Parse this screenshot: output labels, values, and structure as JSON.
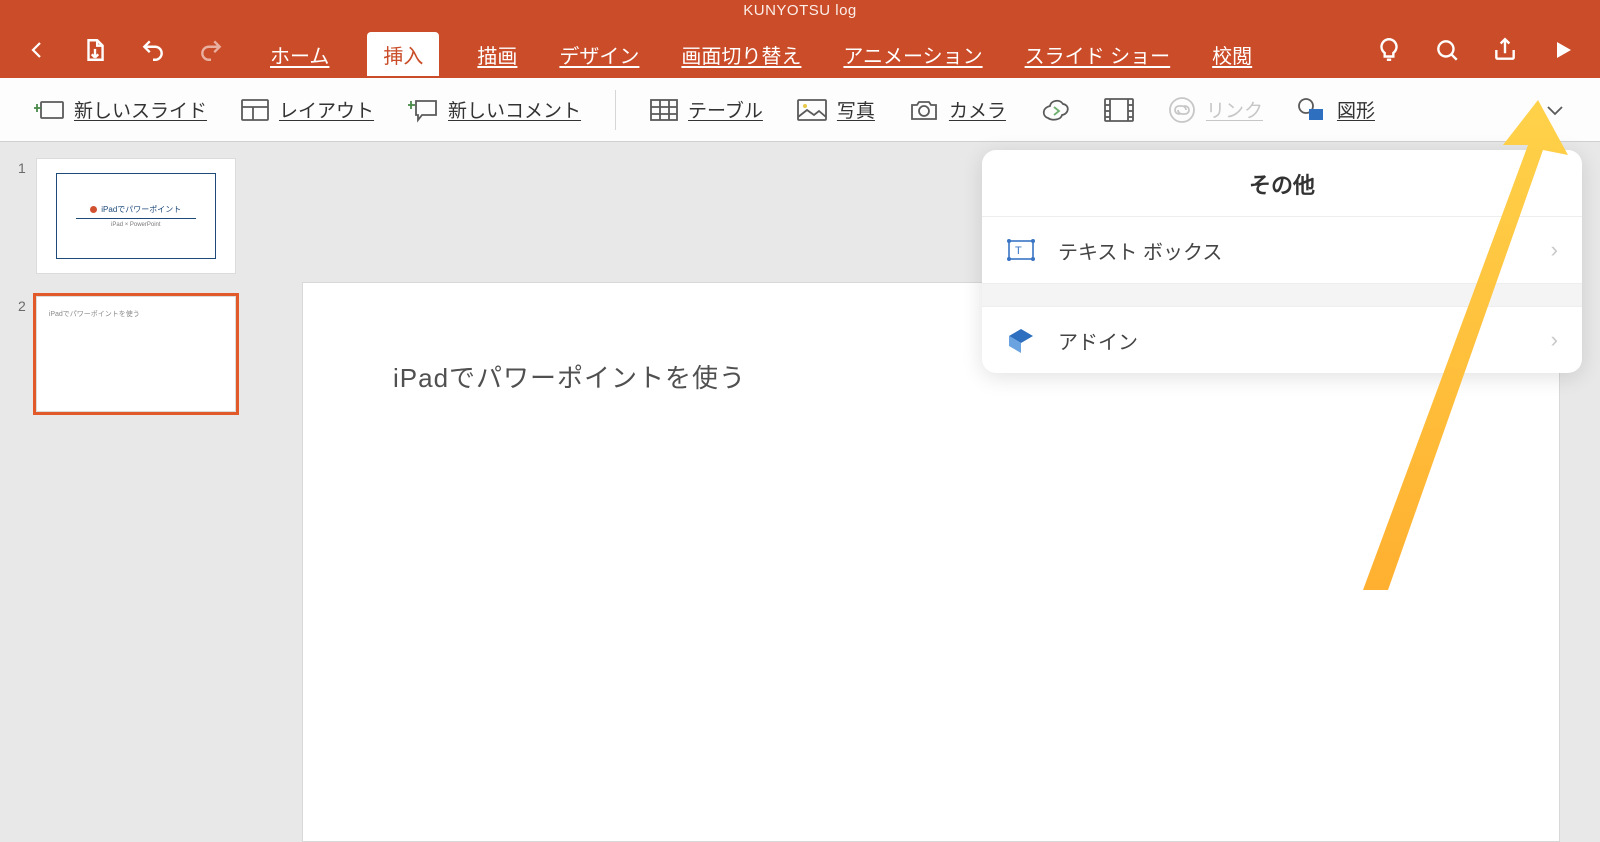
{
  "app": {
    "title": "KUNYOTSU log"
  },
  "tabs": {
    "home": "ホーム",
    "insert": "挿入",
    "draw": "描画",
    "design": "デザイン",
    "transitions": "画面切り替え",
    "animations": "アニメーション",
    "slideshow": "スライド ショー",
    "review": "校閲"
  },
  "ribbon": {
    "new_slide": "新しいスライド",
    "layout": "レイアウト",
    "new_comment": "新しいコメント",
    "table": "テーブル",
    "photo": "写真",
    "camera": "カメラ",
    "link": "リンク",
    "shapes": "図形"
  },
  "slides": {
    "s1": {
      "num": "1",
      "title": "iPadでパワーポイント",
      "subtitle": "iPad × PowerPoint"
    },
    "s2": {
      "num": "2",
      "small": "iPadでパワーポイントを使う"
    }
  },
  "canvas": {
    "text": "iPadでパワーポイントを使う"
  },
  "popup": {
    "header": "その他",
    "textbox": "テキスト ボックス",
    "addin": "アドイン"
  }
}
